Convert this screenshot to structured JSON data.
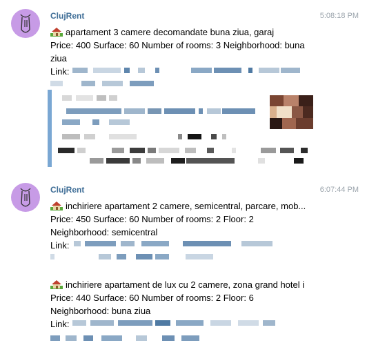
{
  "messages": [
    {
      "sender": "ClujRent",
      "time": "5:08:18 PM",
      "posts": [
        {
          "title": "apartament 3 camere decomandate buna ziua, garaj",
          "details_1": "Price: 400 Surface: 60 Number of rooms: 3 Neighborhood: buna",
          "details_2": "ziua",
          "link_label": "Link:"
        }
      ]
    },
    {
      "sender": "ClujRent",
      "time": "6:07:44 PM",
      "posts": [
        {
          "title": "inchiriere apartament 2 camere, semicentral, parcare, mob...",
          "details_1": "Price: 450 Surface: 60 Number of rooms: 2 Floor: 2",
          "details_2": "Neighborhood: semicentral",
          "link_label": "Link:"
        },
        {
          "title": "inchiriere apartament de lux cu 2 camere, zona grand hotel i",
          "details_1": "Price: 440 Surface: 60 Number of rooms: 2 Floor: 6",
          "details_2": "Neighborhood: buna ziua",
          "link_label": "Link:"
        }
      ]
    }
  ],
  "colors": {
    "sender": "#3e6d96",
    "avatar_bg": "#c79be6",
    "preview_bar": "#7aa7d3",
    "timestamp": "#9aa3ab"
  },
  "icons": [
    "house-emoji-icon",
    "avatar-bot-icon",
    "redacted-link",
    "link-preview-thumbnail"
  ]
}
